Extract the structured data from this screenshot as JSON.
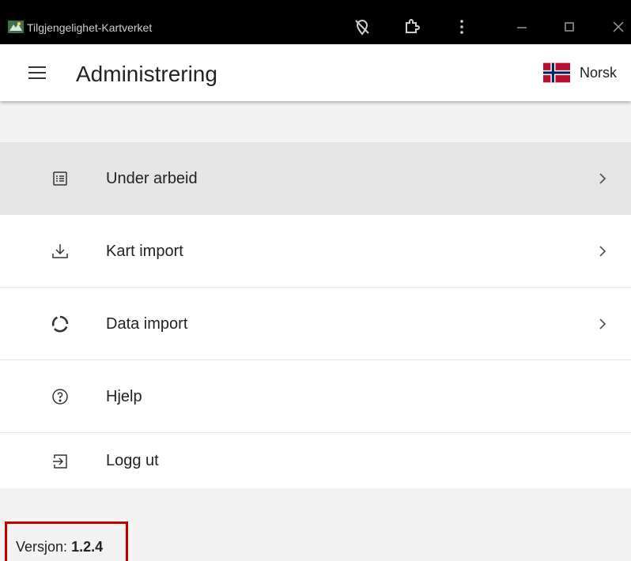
{
  "window": {
    "title": "Tilgjengelighet-Kartverket",
    "app_icon": "kartverket-app-icon",
    "controls": [
      "location-off-icon",
      "extensions-icon",
      "more-vert-icon",
      "minimize-icon",
      "maximize-icon",
      "close-icon"
    ]
  },
  "appbar": {
    "menu_icon": "menu-icon",
    "title": "Administrering",
    "language": {
      "label": "Norsk",
      "flag": "norway-flag-icon"
    }
  },
  "menu": {
    "items": [
      {
        "label": "Under arbeid",
        "icon": "list-icon",
        "active": true,
        "has_chevron": true
      },
      {
        "label": "Kart import",
        "icon": "download-icon",
        "active": false,
        "has_chevron": true
      },
      {
        "label": "Data import",
        "icon": "progress-ring-icon",
        "active": false,
        "has_chevron": true
      },
      {
        "label": "Hjelp",
        "icon": "help-icon",
        "active": false,
        "has_chevron": false
      },
      {
        "label": "Logg ut",
        "icon": "logout-icon",
        "active": false,
        "has_chevron": false
      }
    ]
  },
  "footer": {
    "version_label": "Versjon:",
    "version_value": "1.2.4",
    "highlight_color": "#c00000"
  },
  "colors": {
    "titlebar": "#000000",
    "active_item": "#e5e5e5",
    "flag_red": "#ba0c2f",
    "flag_blue": "#00205b"
  }
}
